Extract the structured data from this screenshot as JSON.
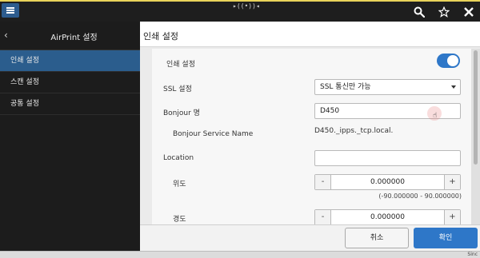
{
  "topbar": {
    "center_text": "▸((•))◂",
    "icons": [
      "search-icon",
      "star-icon",
      "close-icon"
    ]
  },
  "sidebar": {
    "title": "AirPrint 설정",
    "items": [
      {
        "label": "인쇄 설정",
        "active": true
      },
      {
        "label": "스캔 설정",
        "active": false
      },
      {
        "label": "공통 설정",
        "active": false
      }
    ]
  },
  "content": {
    "title": "인쇄 설정",
    "print_setting_label": "인쇄 설정",
    "print_setting_enabled": true,
    "ssl_label": "SSL 설정",
    "ssl_value": "SSL 통신만 가능",
    "bonjour_label": "Bonjour 명",
    "bonjour_value": "D450",
    "service_name_label": "Bonjour Service Name",
    "service_name_value": "D450._ipps._tcp.local.",
    "location_label": "Location",
    "location_value": "",
    "latitude_label": "위도",
    "latitude_value": "0.000000",
    "latitude_range": "(-90.000000 - 90.000000)",
    "longitude_label": "경도",
    "longitude_value": "0.000000",
    "stepper_minus": "-",
    "stepper_plus": "+"
  },
  "footer": {
    "cancel_label": "취소",
    "ok_label": "확인"
  },
  "bottom_strip": {
    "tag": "Sinc"
  },
  "colors": {
    "accent": "#2e77c8",
    "sidebar_active": "#2b5d8d",
    "topbar_border": "#e8d35a"
  }
}
